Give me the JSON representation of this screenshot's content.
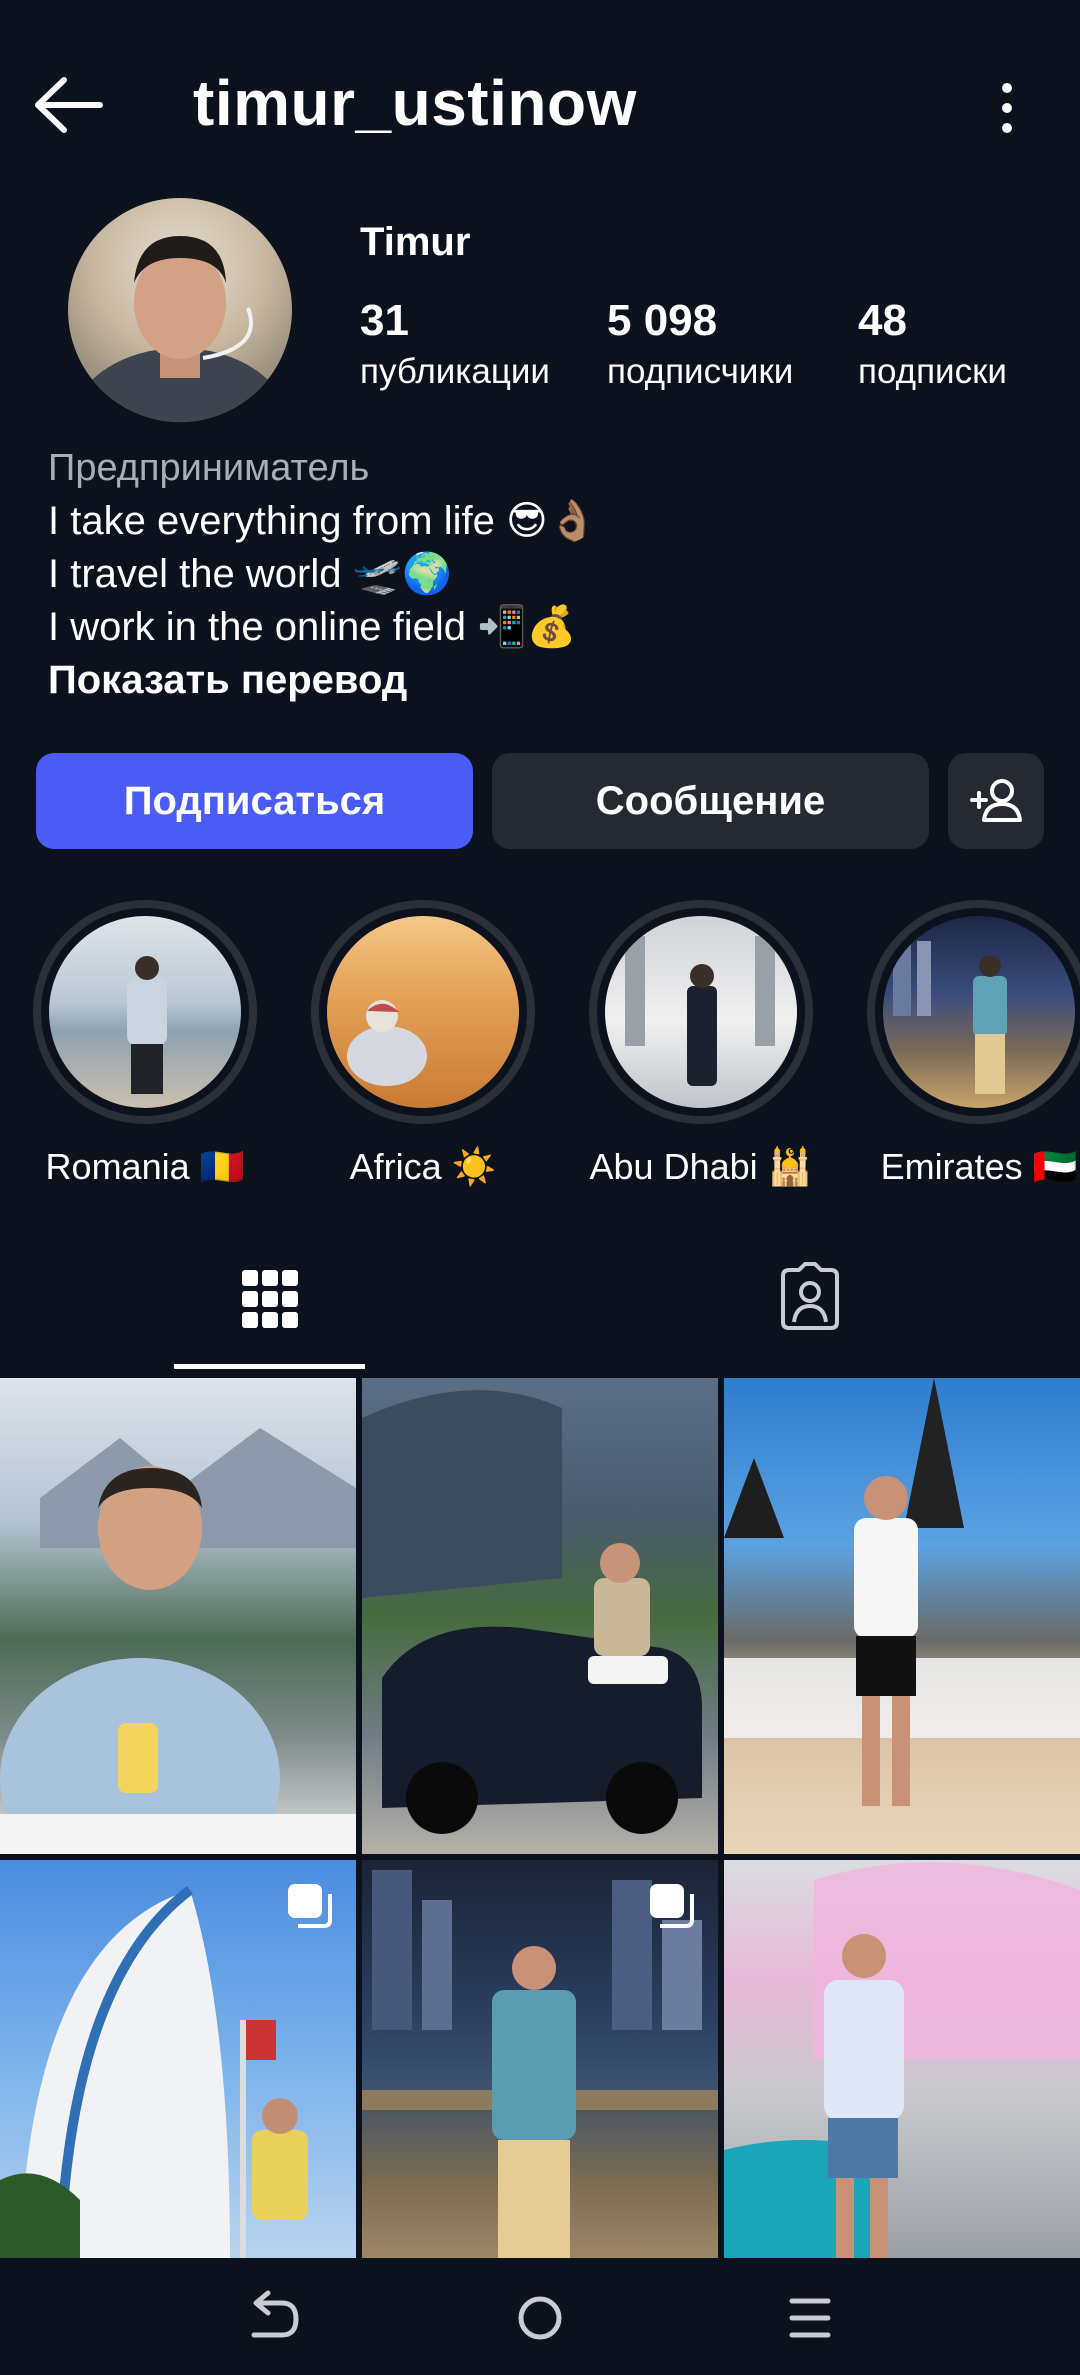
{
  "header": {
    "username": "timur_ustinow"
  },
  "profile": {
    "display_name": "Timur",
    "stats": [
      {
        "value": "31",
        "label": "публикации"
      },
      {
        "value": "5 098",
        "label": "подписчики"
      },
      {
        "value": "48",
        "label": "подписки"
      }
    ],
    "bio_category": "Предприниматель",
    "bio_lines": [
      "I take everything from life 😎👌🏽",
      "I travel the world 🛫🌍",
      "I work in the online field 📲💰"
    ],
    "show_translation": "Показать перевод"
  },
  "actions": {
    "follow": "Подписаться",
    "message": "Сообщение"
  },
  "highlights": [
    {
      "label": "Romania 🇷🇴"
    },
    {
      "label": "Africa ☀️"
    },
    {
      "label": "Abu Dhabi 🕌"
    },
    {
      "label": "Emirates 🇦🇪"
    }
  ],
  "tabs": [
    {
      "icon": "grid-icon",
      "active": true
    },
    {
      "icon": "tagged-user-icon",
      "active": false
    }
  ],
  "colors": {
    "background": "#0b111d",
    "accent": "#4b5cf6",
    "button_dark": "#252a32",
    "muted_text": "#a8adb6"
  }
}
